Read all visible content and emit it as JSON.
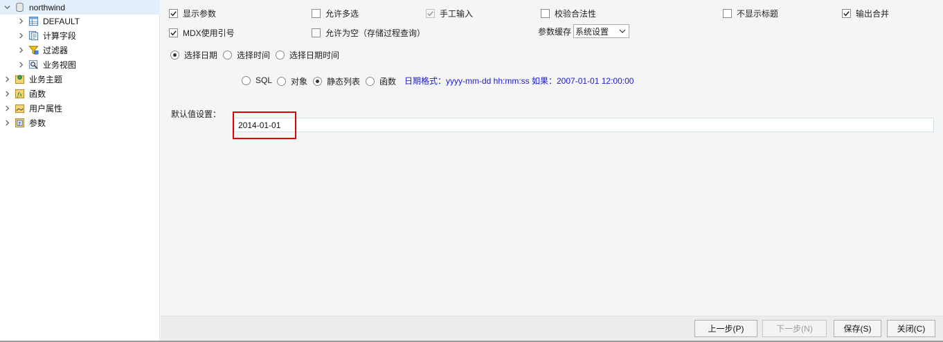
{
  "tree": {
    "root": {
      "label": "northwind",
      "expanded": true
    },
    "children": [
      {
        "label": "DEFAULT",
        "icon": "table-icon"
      },
      {
        "label": "计算字段",
        "icon": "calc-field-icon"
      },
      {
        "label": "过滤器",
        "icon": "filter-icon"
      },
      {
        "label": "业务视图",
        "icon": "business-view-icon"
      }
    ],
    "top_items": [
      {
        "label": "业务主题",
        "icon": "business-topic-icon"
      },
      {
        "label": "函数",
        "icon": "function-icon"
      },
      {
        "label": "用户属性",
        "icon": "user-attr-icon"
      },
      {
        "label": "参数",
        "icon": "param-icon"
      }
    ]
  },
  "options": {
    "show_param": {
      "label": "显示参数",
      "checked": true
    },
    "allow_multi": {
      "label": "允许多选",
      "checked": false
    },
    "manual_input": {
      "label": "手工输入",
      "checked": true,
      "disabled": true
    },
    "validate": {
      "label": "校验合法性",
      "checked": false
    },
    "hide_title": {
      "label": "不显示标题",
      "checked": false
    },
    "merge_output": {
      "label": "输出合并",
      "checked": true
    },
    "mdx_quote": {
      "label": "MDX使用引号",
      "checked": true
    },
    "allow_empty": {
      "label": "允许为空（存储过程查询）",
      "checked": false
    },
    "cache": {
      "label": "参数缓存",
      "value": "系统设置"
    }
  },
  "date_mode": {
    "selected": 0,
    "items": [
      "选择日期",
      "选择时间",
      "选择日期时间"
    ]
  },
  "source": {
    "selected": 2,
    "items": [
      "SQL",
      "对象",
      "静态列表",
      "函数"
    ],
    "hint": "日期格式：yyyy-mm-dd hh:mm:ss 如果：2007-01-01 12:00:00"
  },
  "default_value": {
    "label": "默认值设置：",
    "value": "2014-01-01"
  },
  "buttons": {
    "prev": "上一步(P)",
    "next": "下一步(N)",
    "save": "保存(S)",
    "close": "关闭(C)"
  },
  "colors": {
    "hint_text": "#1a1ad0",
    "highlight_border": "#e00000",
    "selection": "#e3effa"
  }
}
